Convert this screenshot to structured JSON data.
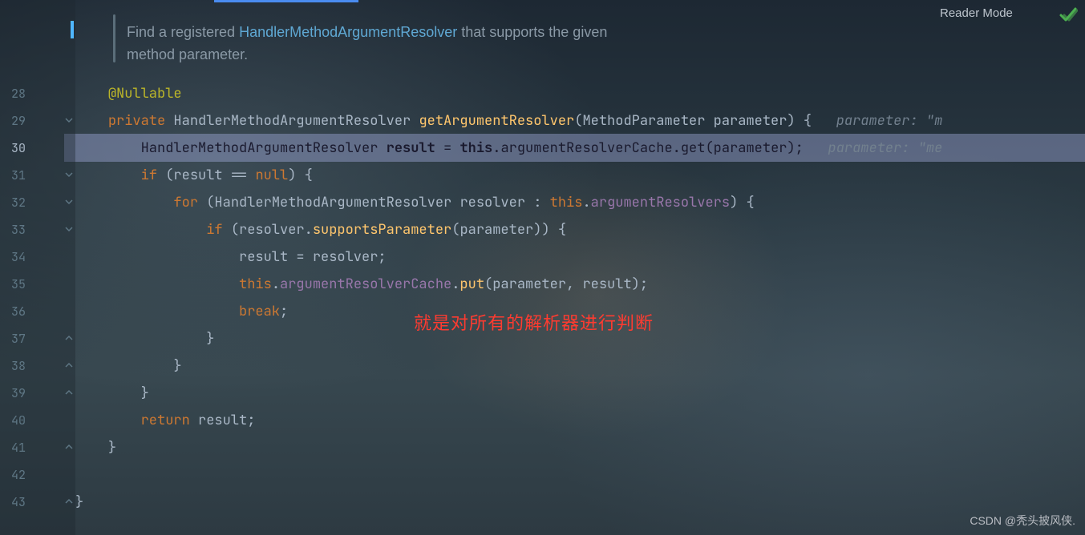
{
  "header": {
    "reader_mode": "Reader Mode"
  },
  "lines": [
    "28",
    "29",
    "30",
    "31",
    "32",
    "33",
    "34",
    "35",
    "36",
    "37",
    "38",
    "39",
    "40",
    "41",
    "42",
    "43"
  ],
  "current_line": "30",
  "javadoc": {
    "pre": "Find a registered ",
    "link": "HandlerMethodArgumentResolver",
    "post": " that supports the given",
    "line2": "method parameter."
  },
  "code": {
    "l28": {
      "ann": "@Nullable"
    },
    "l29": {
      "kw1": "private",
      "type": "HandlerMethodArgumentResolver",
      "mtd": "getArgumentResolver",
      "p_type": "MethodParameter",
      "p_name": "parameter",
      "hint_label": "parameter:",
      "hint_val": "\"m"
    },
    "l30": {
      "type": "HandlerMethodArgumentResolver",
      "var": "result",
      "kw_this": "this",
      "field": "argumentResolverCache",
      "call": "get",
      "arg": "parameter",
      "hint_label": "parameter:",
      "hint_val": "\"me"
    },
    "l31": {
      "kw_if": "if",
      "var": "result",
      "kw_null": "null"
    },
    "l32": {
      "kw_for": "for",
      "type": "HandlerMethodArgumentResolver",
      "var": "resolver",
      "kw_this": "this",
      "field": "argumentResolvers"
    },
    "l33": {
      "kw_if": "if",
      "obj": "resolver",
      "mtd": "supportsParameter",
      "arg": "parameter"
    },
    "l34": {
      "lhs": "result",
      "rhs": "resolver"
    },
    "l35": {
      "kw_this": "this",
      "field": "argumentResolverCache",
      "mtd": "put",
      "a1": "parameter",
      "a2": "result"
    },
    "l36": {
      "kw_break": "break"
    },
    "l40": {
      "kw_return": "return",
      "var": "result"
    }
  },
  "annotation": "就是对所有的解析器进行判断",
  "watermark": "CSDN @秃头披风侠."
}
